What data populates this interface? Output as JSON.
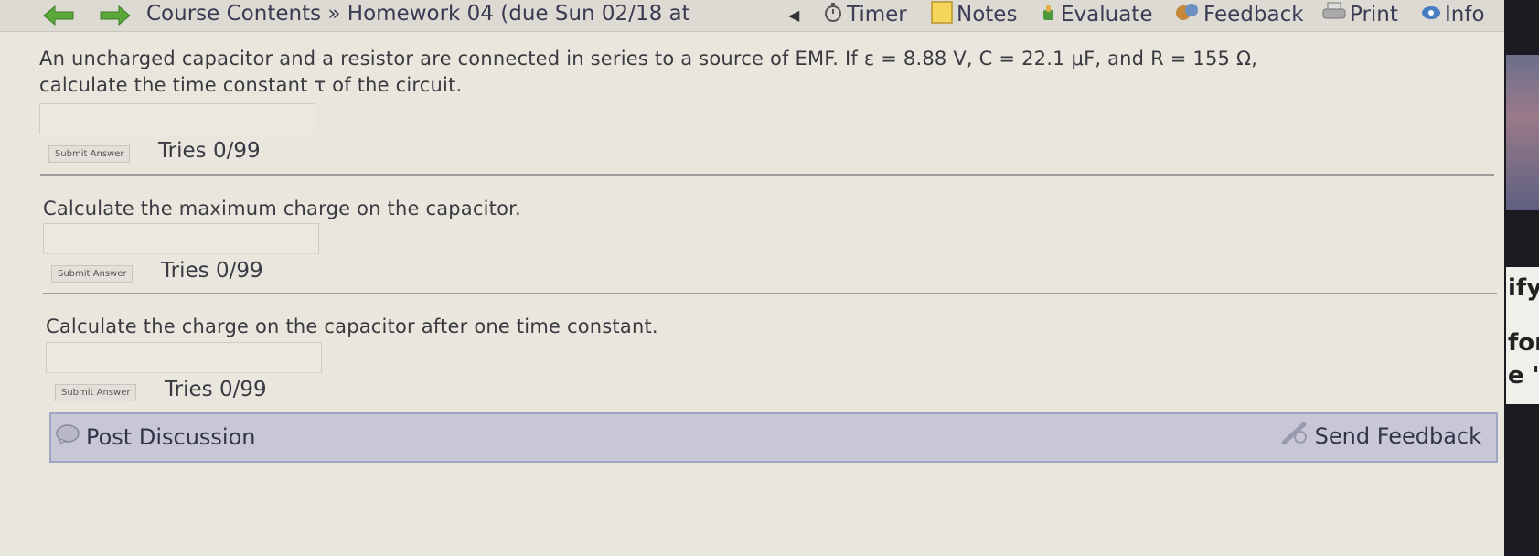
{
  "toolbar": {
    "back_icon": "back-arrow-icon",
    "forward_icon": "forward-arrow-icon",
    "breadcrumb_root": "Course Contents",
    "breadcrumb_sep": "»",
    "breadcrumb_current": "Homework 04 (due Sun 02/18 at",
    "timer_label": "Timer",
    "notes_label": "Notes",
    "evaluate_label": "Evaluate",
    "feedback_label": "Feedback",
    "print_label": "Print",
    "info_label": "Info"
  },
  "questions": [
    {
      "line1": "An uncharged capacitor and a resistor are connected in series to a source of EMF. If ε = 8.88 V, C = 22.1 μF, and R = 155 Ω,",
      "line2": "calculate the time constant τ of the circuit.",
      "answer_value": "",
      "submit_label": "Submit Answer",
      "tries": "Tries 0/99"
    },
    {
      "line1": "Calculate the maximum charge on the capacitor.",
      "answer_value": "",
      "submit_label": "Submit Answer",
      "tries": "Tries 0/99"
    },
    {
      "line1": "Calculate the charge on the capacitor after one time constant.",
      "answer_value": "",
      "submit_label": "Submit Answer",
      "tries": "Tries 0/99"
    }
  ],
  "discussion": {
    "post_label": "Post Discussion",
    "send_label": "Send Feedback"
  },
  "side_partial": {
    "word1": "ify",
    "word2": "for",
    "word3": "e '"
  },
  "colors": {
    "page_bg": "#e9e6dd",
    "accent_bar": "#c7c7d5",
    "nav_arrow": "#5aa83a"
  }
}
